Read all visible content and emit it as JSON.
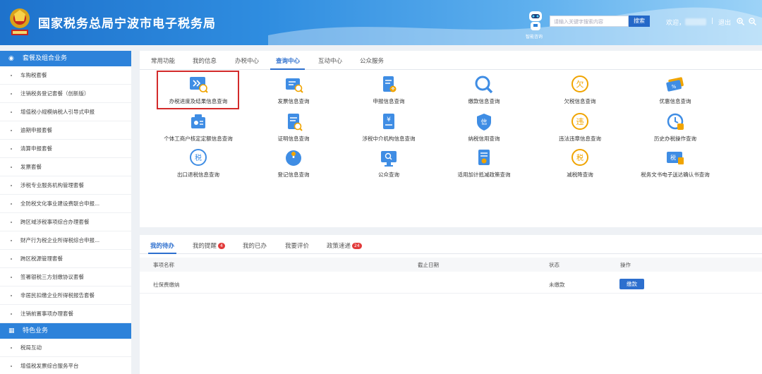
{
  "header": {
    "title": "国家税务总局宁波市电子税务局",
    "robot_label": "智能咨询",
    "search_placeholder": "请输入关键字搜索内容",
    "search_button": "搜索",
    "welcome": "欢迎，",
    "separator": "|",
    "logout": "退出"
  },
  "sidebar": {
    "section1": "套餐及组合业务",
    "items1": [
      "车购税套餐",
      "注销税务登记套餐（创新版）",
      "增值税小规模纳税人引导式申报",
      "逾期申报套餐",
      "清算申报套餐",
      "发票套餐",
      "涉税专业服务机构管理套餐",
      "全防税文化事业建设费联合申报...",
      "跨区域涉税事项综合办理套餐",
      "财产行为税企业所得税综合申报...",
      "跨区税源管理套餐",
      "签署银税三方划缴协议套餐",
      "非居民扣缴企业所得税报告套餐",
      "注销前置事项办理套餐"
    ],
    "section2": "特色业务",
    "items2": [
      "税局互动",
      "增值税发票综合服务平台"
    ]
  },
  "tabs": [
    "常用功能",
    "我的信息",
    "办税中心",
    "查询中心",
    "互动中心",
    "公众服务"
  ],
  "grid": [
    [
      "办税进度及结果信息查询",
      "发票信息查询",
      "申报信息查询",
      "缴款信息查询",
      "欠税信息查询",
      "优惠信息查询"
    ],
    [
      "个体工商户核定定额信息查询",
      "证明信息查询",
      "涉税中介机构信息查询",
      "纳税信用查询",
      "违法违章信息查询",
      "历史办税操作查询"
    ],
    [
      "出口退税信息查询",
      "登记信息查询",
      "公众查询",
      "适用加计抵减政策查询",
      "减税降查询",
      "税务文书电子送达确认书查询"
    ]
  ],
  "bottom": {
    "tabs": [
      "我的待办",
      "我的提醒",
      "我的已办",
      "我要评价",
      "政策速递"
    ],
    "badges": {
      "reminder": "4",
      "policy": "24"
    },
    "columns": [
      "事项名称",
      "截止日期",
      "状态",
      "操作"
    ],
    "row": {
      "name": "社保费缴纳",
      "deadline": "",
      "status": "未缴款",
      "action": "缴款"
    }
  },
  "colors": {
    "primary": "#2d6fce",
    "highlight": "#d32b2b",
    "sidebar_header": "#2d82da"
  }
}
